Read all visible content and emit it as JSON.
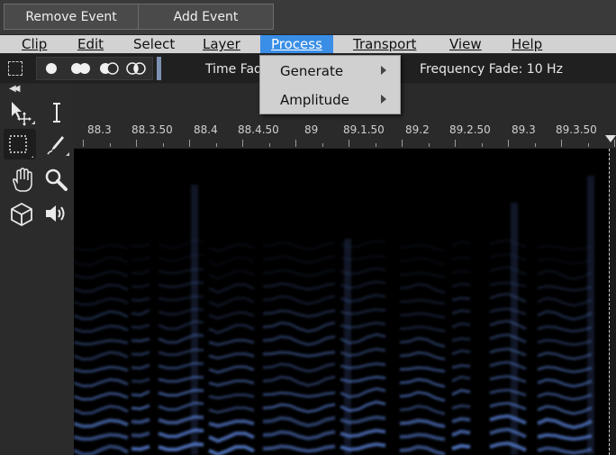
{
  "topbar": {
    "remove_label": "Remove Event",
    "add_label": "Add Event"
  },
  "menu": {
    "clip": "Clip",
    "edit": "Edit",
    "select": "Select",
    "layer": "Layer",
    "process": "Process",
    "transport": "Transport",
    "view": "View",
    "help": "Help"
  },
  "toolbar": {
    "time_fade": "Time Fad",
    "frequency_fade": "Frequency Fade: 10  Hz"
  },
  "ruler": {
    "ticks": [
      "88.3",
      "88.3.50",
      "88.4",
      "88.4.50",
      "89",
      "89.1.50",
      "89.2",
      "89.2.50",
      "89.3",
      "89.3.50"
    ]
  },
  "dropdown": {
    "generate": "Generate",
    "amplitude": "Amplitude"
  },
  "colors": {
    "accent": "#3a8ee6",
    "spectrogram": "#5a82d8"
  }
}
